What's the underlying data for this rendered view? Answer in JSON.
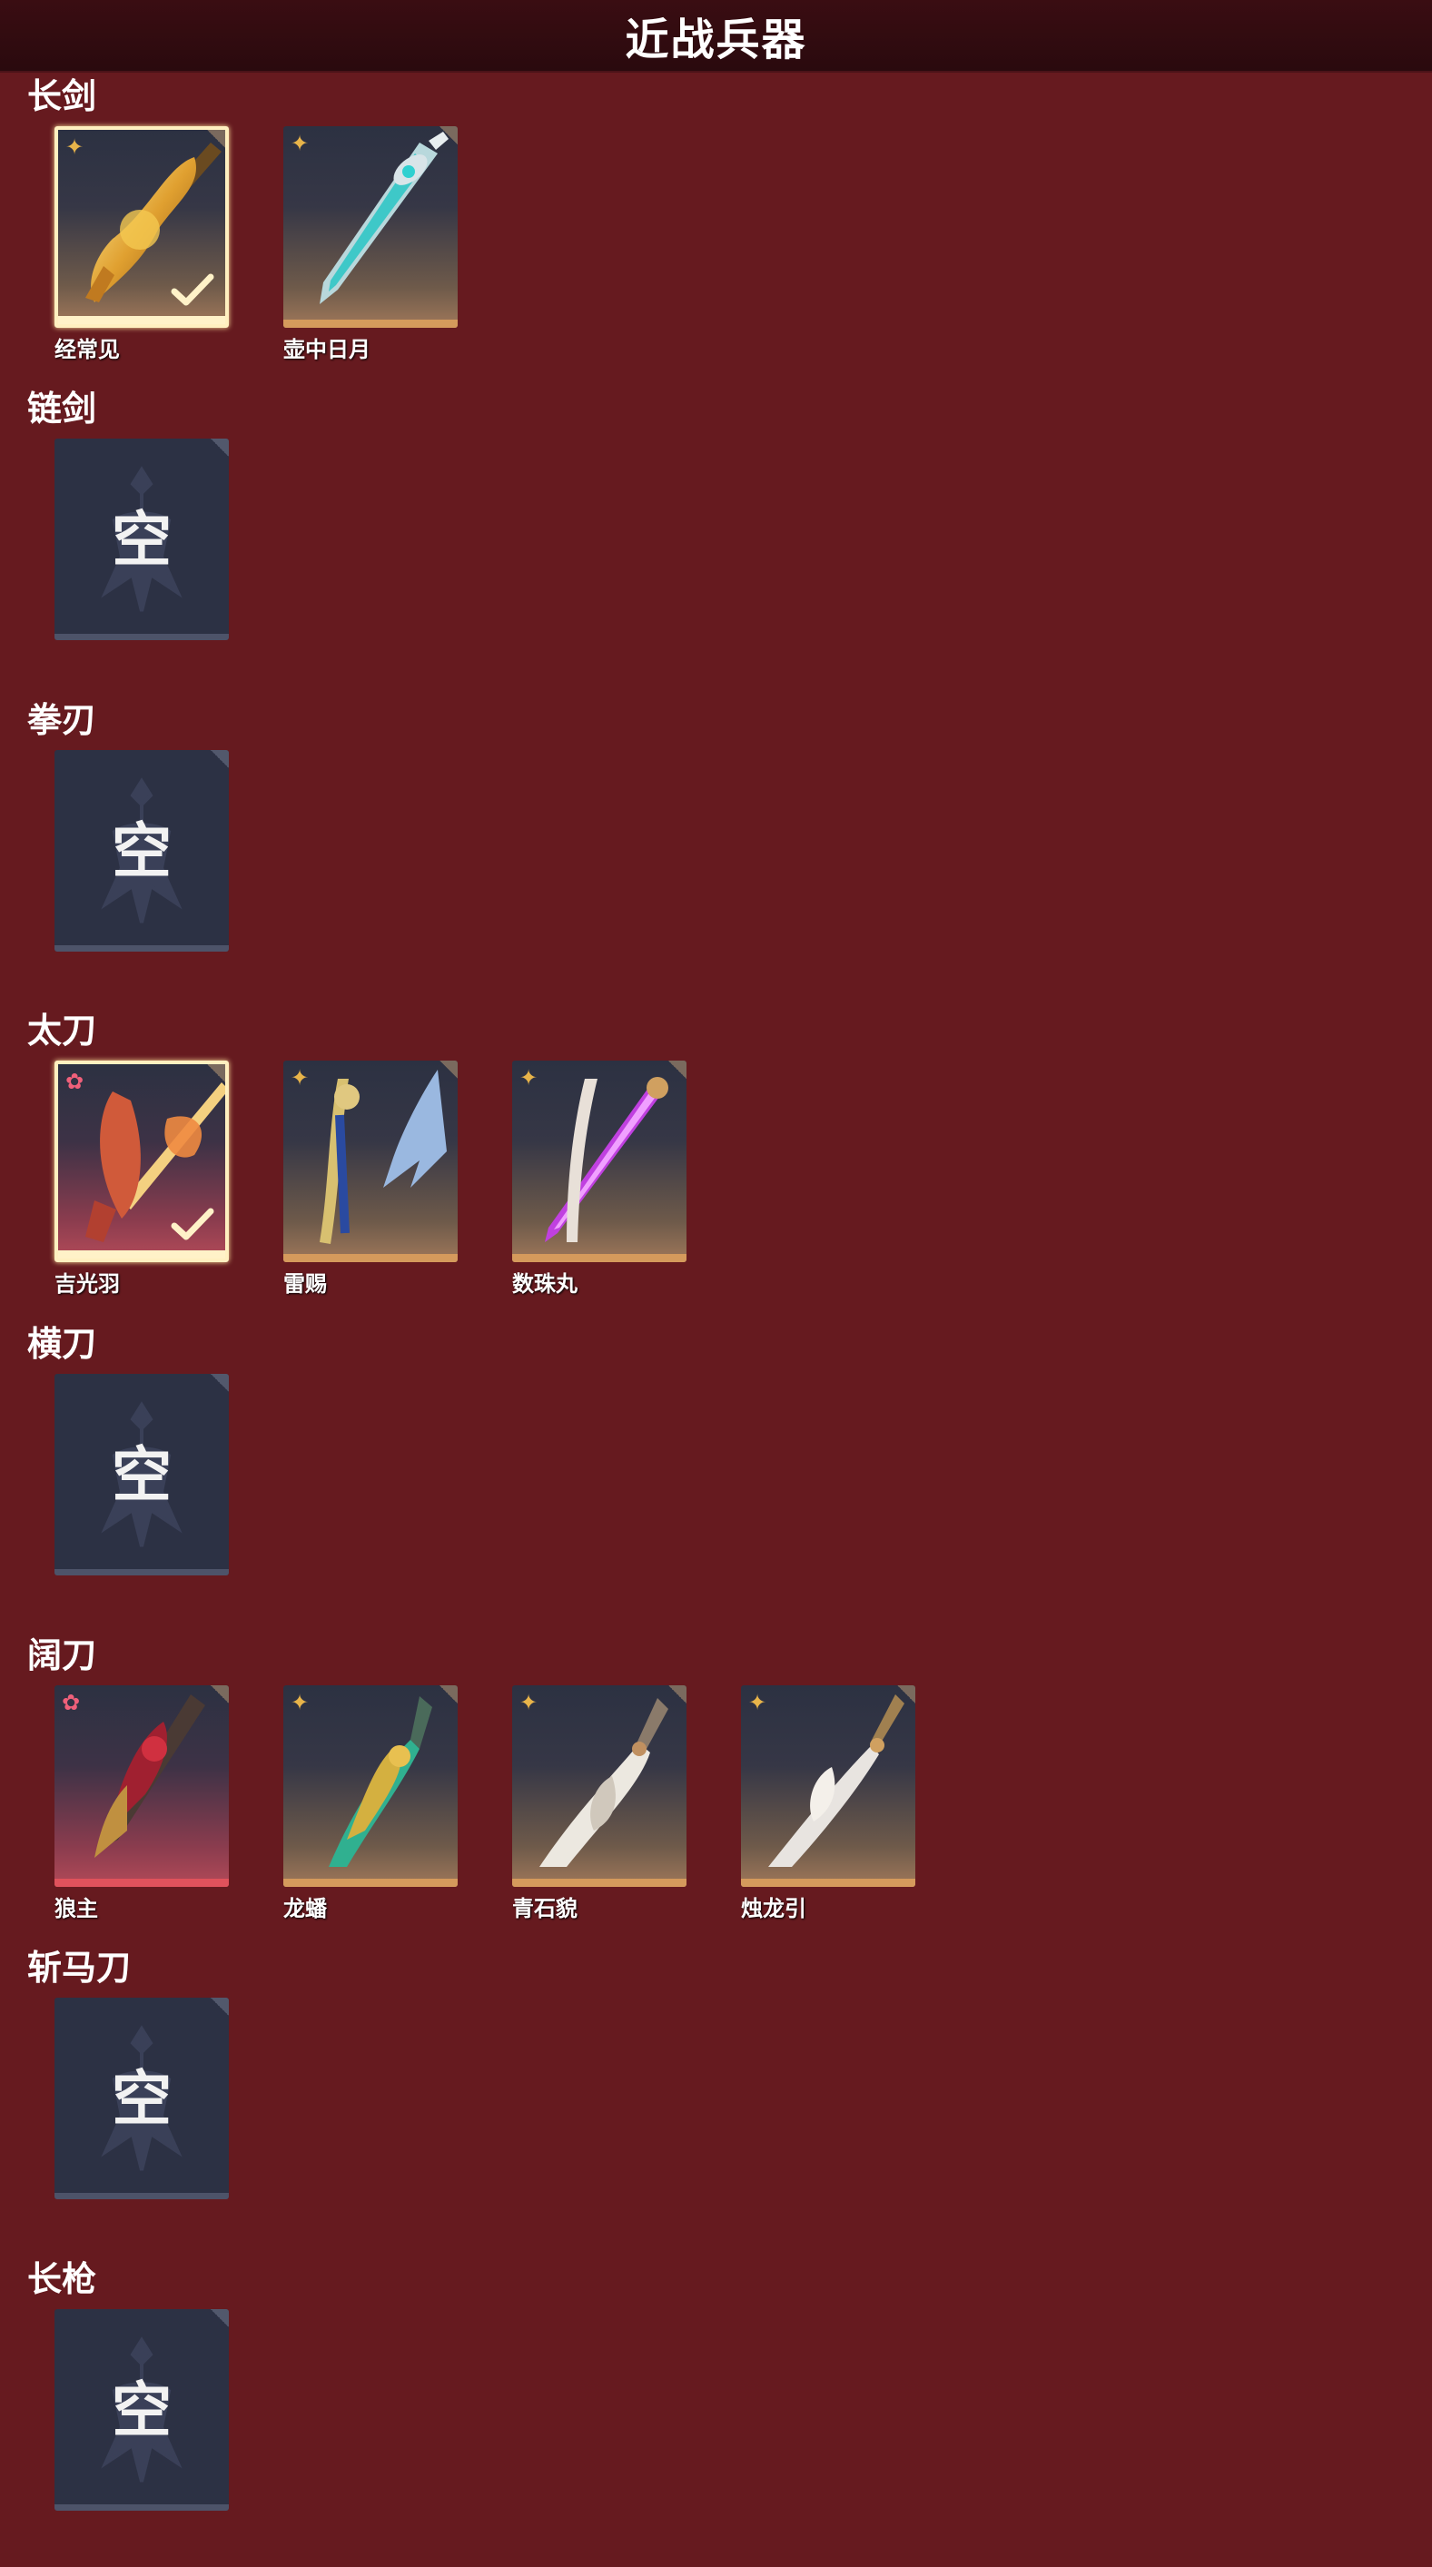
{
  "header": {
    "title": "近战兵器"
  },
  "empty_label": "空",
  "colors": {
    "background": "#661A1F",
    "header": "#2a0a0e",
    "gold_rarity": "#e8b44a",
    "red_rarity": "#f0607a",
    "empty_slot": "#2c3144"
  },
  "categories": [
    {
      "title": "长剑",
      "items": [
        {
          "name": "经常见",
          "rarity": "gold",
          "equipped": true,
          "art": "golden-ornate-sword"
        },
        {
          "name": "壶中日月",
          "rarity": "gold",
          "equipped": false,
          "art": "cyan-crystal-sword"
        }
      ]
    },
    {
      "title": "链剑",
      "items": []
    },
    {
      "title": "拳刃",
      "items": []
    },
    {
      "title": "太刀",
      "items": [
        {
          "name": "吉光羽",
          "rarity": "red",
          "equipped": true,
          "art": "flame-feather-katana"
        },
        {
          "name": "雷赐",
          "rarity": "gold",
          "equipped": false,
          "art": "lightning-katana"
        },
        {
          "name": "数珠丸",
          "rarity": "gold",
          "equipped": false,
          "art": "violet-katana"
        }
      ]
    },
    {
      "title": "横刀",
      "items": []
    },
    {
      "title": "阔刀",
      "items": [
        {
          "name": "狼主",
          "rarity": "red",
          "equipped": false,
          "art": "crimson-wolf-broadsword"
        },
        {
          "name": "龙蟠",
          "rarity": "gold",
          "equipped": false,
          "art": "jade-dragon-broadsword"
        },
        {
          "name": "青石貌",
          "rarity": "gold",
          "equipped": false,
          "art": "white-beast-broadsword"
        },
        {
          "name": "烛龙引",
          "rarity": "gold",
          "equipped": false,
          "art": "silver-dragon-broadsword"
        }
      ]
    },
    {
      "title": "斩马刀",
      "items": []
    },
    {
      "title": "长枪",
      "items": []
    }
  ]
}
